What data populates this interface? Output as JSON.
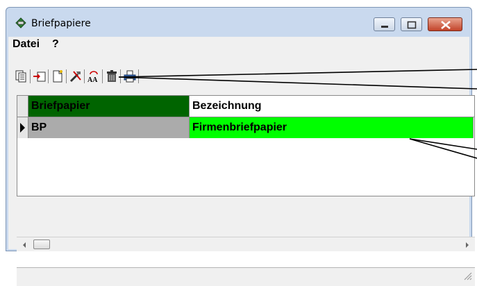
{
  "window": {
    "title": "Briefpapiere"
  },
  "menu": {
    "items": [
      "Datei",
      "?"
    ]
  },
  "toolbar": {
    "buttons": [
      "copy-icon",
      "import-icon",
      "new-document-icon",
      "tools-icon",
      "font-icon",
      "delete-icon",
      "print-icon"
    ]
  },
  "grid": {
    "columns": [
      "Briefpapier",
      "Bezeichnung"
    ],
    "rows": [
      {
        "briefpapier": "BP",
        "bezeichnung": "Firmenbriefpapier"
      }
    ]
  },
  "colors": {
    "header_briefpapier_bg": "#006400",
    "header_bezeichnung_bg": "#ffffff",
    "selected_cell_bg": "#00ff00",
    "key_cell_bg": "#ababab",
    "close_button": "#c2432a"
  }
}
